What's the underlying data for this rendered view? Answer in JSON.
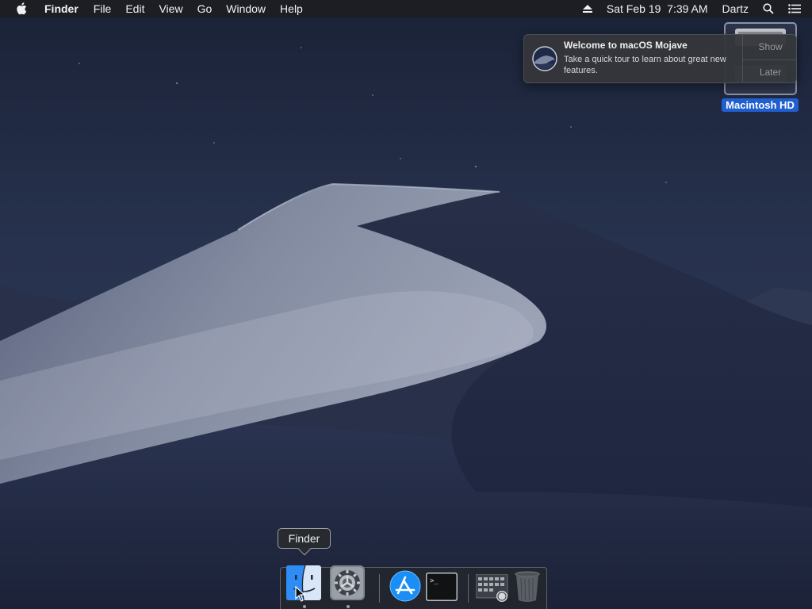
{
  "menubar": {
    "app_name": "Finder",
    "items": [
      "File",
      "Edit",
      "View",
      "Go",
      "Window",
      "Help"
    ],
    "clock": "Sat Feb 19  7:39 AM",
    "user": "Dartz",
    "icons": [
      "apple-icon",
      "eject-icon",
      "spotlight-search-icon",
      "notification-center-icon"
    ]
  },
  "desktop": {
    "drive_label": "Macintosh HD",
    "drive_icon": "hard-drive-icon"
  },
  "notification": {
    "title": "Welcome to macOS Mojave",
    "body": "Take a quick tour to learn about great new features.",
    "show_label": "Show",
    "later_label": "Later",
    "icon": "mojave-icon"
  },
  "dock": {
    "tooltip": "Finder",
    "items": [
      "finder-icon",
      "system-preferences-icon",
      "app-store-icon",
      "terminal-icon",
      "downloads-stack-icon",
      "trash-icon"
    ]
  },
  "colors": {
    "selection_blue": "#1f5fd0",
    "sky": "#1d2740"
  }
}
